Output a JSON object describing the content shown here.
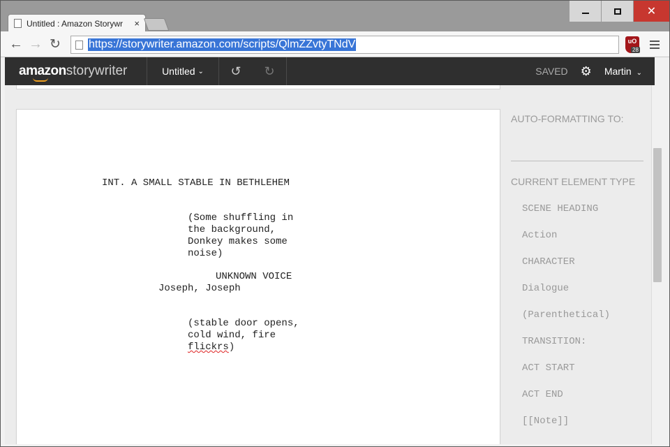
{
  "browser": {
    "tab_title": "Untitled : Amazon Storywr",
    "tab_close": "×",
    "url": "https://storywriter.amazon.com/scripts/QlmZZvtyTNdV",
    "ext_label": "uO",
    "ext_badge": "28",
    "window_close": "✕"
  },
  "app": {
    "logo_bold": "amazon",
    "logo_thin": "storywriter",
    "document_title": "Untitled",
    "save_status": "SAVED",
    "user_name": "Martin"
  },
  "script": {
    "scene_heading": "INT. A SMALL STABLE IN BETHLEHEM",
    "parenthetical_1": [
      "(Some shuffling in",
      "the background,",
      "Donkey makes some",
      "noise)"
    ],
    "character": "UNKNOWN VOICE",
    "dialogue": "Joseph, Joseph",
    "parenthetical_2": [
      "(stable door opens,",
      "cold wind, fire"
    ],
    "parenthetical_2_last_word": "flickrs",
    "parenthetical_2_end": ")"
  },
  "sidebar": {
    "auto_formatting_label": "AUTO-FORMATTING TO:",
    "current_type_label": "CURRENT ELEMENT TYPE",
    "element_types": [
      "SCENE HEADING",
      "Action",
      "CHARACTER",
      "Dialogue",
      "(Parenthetical)",
      "TRANSITION:",
      "ACT START",
      "ACT END",
      "[[Note]]"
    ]
  },
  "colors": {
    "app_bar": "#2f2f2f",
    "url_highlight": "#3875d7",
    "close_button": "#c7372f",
    "sidebar_text": "#999999"
  }
}
